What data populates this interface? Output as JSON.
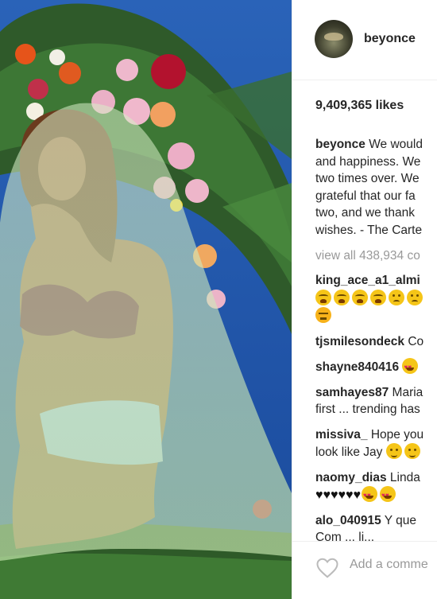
{
  "post": {
    "username": "beyonce",
    "likes": "9,409,365 likes",
    "caption_lines": [
      "We would",
      "and happiness. We",
      "two times over. We",
      "grateful that our fa",
      "two, and we thank",
      "wishes. - The Carte"
    ],
    "view_all": "view all 438,934 co",
    "add_comment_placeholder": "Add a comme"
  },
  "comments": [
    {
      "user": "king_ace_a1_almi",
      "text": "",
      "line2_emojis": [
        "cry",
        "cry",
        "cry",
        "cry",
        "sad",
        "sad"
      ],
      "line3_emojis": [
        "angry"
      ]
    },
    {
      "user": "tjsmilesondeck",
      "text": "Co"
    },
    {
      "user": "shayne840416",
      "text": "",
      "emojis": [
        "heart-eyes"
      ]
    },
    {
      "user": "samhayes87",
      "text": "Maria",
      "line2": "first ... trending has"
    },
    {
      "user": "missiva_",
      "text": "Hope you",
      "line2": "look like Jay",
      "line2_emojis": [
        "smirk",
        "smirk"
      ]
    },
    {
      "user": "naomy_dias",
      "text": "Linda",
      "hearts": "♥♥♥♥♥♥",
      "line2_emojis": [
        "heart-eyes",
        "heart-eyes"
      ]
    },
    {
      "user": "alo_040915",
      "text": "Y que",
      "line2": "Com ... li..."
    }
  ],
  "colors": {
    "text": "#262626",
    "muted": "#999999",
    "sky": "#1d4fa0",
    "veil": "#c9e6b4"
  },
  "icons": {
    "like": "heart-outline-icon"
  }
}
